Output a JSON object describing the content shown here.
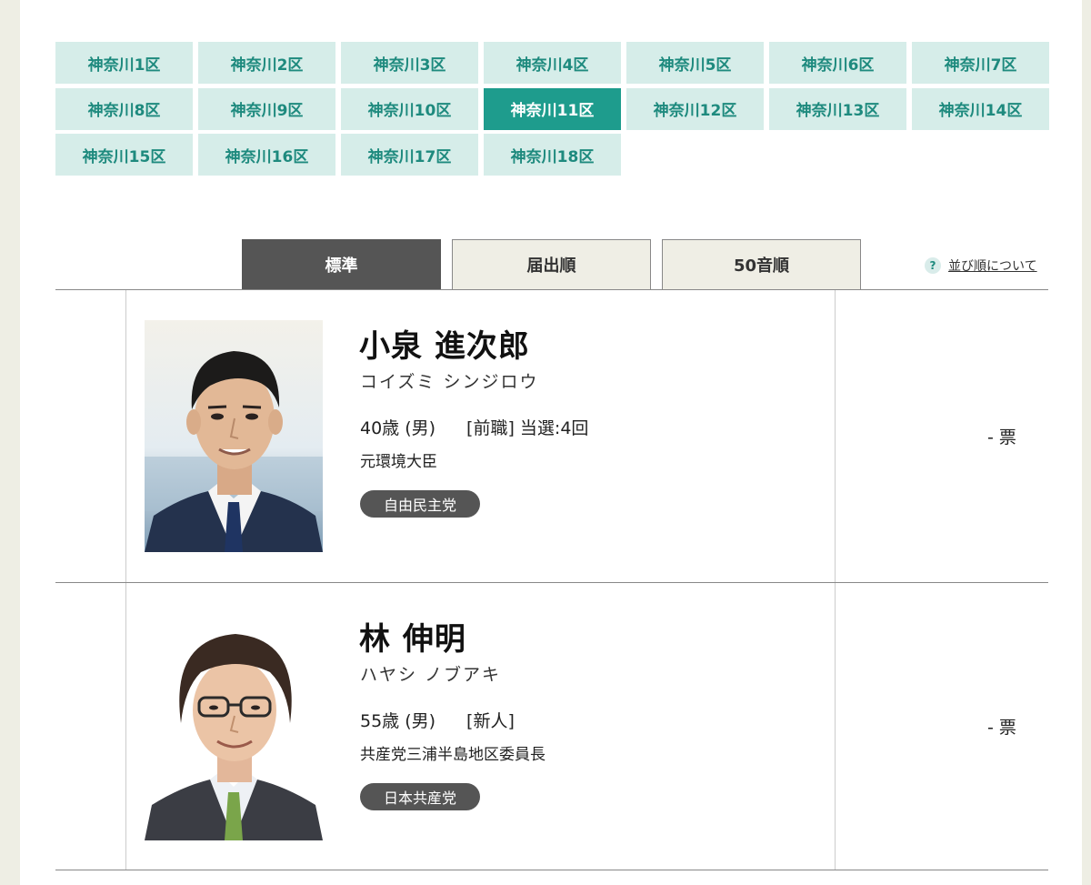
{
  "districts": [
    "神奈川1区",
    "神奈川2区",
    "神奈川3区",
    "神奈川4区",
    "神奈川5区",
    "神奈川6区",
    "神奈川7区",
    "神奈川8区",
    "神奈川9区",
    "神奈川10区",
    "神奈川11区",
    "神奈川12区",
    "神奈川13区",
    "神奈川14区",
    "神奈川15区",
    "神奈川16区",
    "神奈川17区",
    "神奈川18区"
  ],
  "active_district": "神奈川11区",
  "tabs": {
    "standard": "標準",
    "filing_order": "届出順",
    "kana_order": "50音順"
  },
  "sort_help": {
    "icon": "?",
    "label": "並び順について"
  },
  "candidates": [
    {
      "name": "小泉 進次郎",
      "kana": "コイズミ シンジロウ",
      "age_sex": "40歳 (男)",
      "status": "[前職] 当選:4回",
      "career": "元環境大臣",
      "party": "自由民主党",
      "votes": "- 票"
    },
    {
      "name": "林 伸明",
      "kana": "ハヤシ ノブアキ",
      "age_sex": "55歳 (男)",
      "status": "[新人]",
      "career": "共産党三浦半島地区委員長",
      "party": "日本共産党",
      "votes": "- 票"
    }
  ],
  "colors": {
    "district_bg": "#d6ede9",
    "district_text": "#1e8a7e",
    "district_active_bg": "#1e9c8d",
    "tab_active_bg": "#555555",
    "party_badge_bg": "#555555"
  }
}
